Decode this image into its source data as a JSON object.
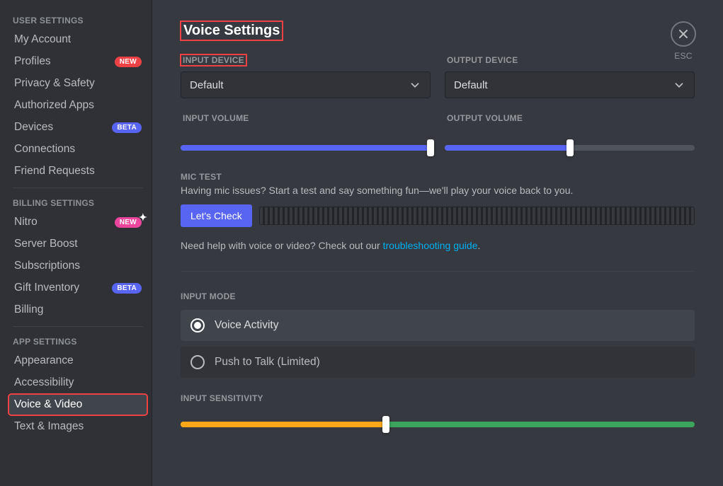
{
  "sidebar": {
    "sections": {
      "user": {
        "header": "USER SETTINGS",
        "items": [
          {
            "label": "My Account"
          },
          {
            "label": "Profiles",
            "badge": "NEW",
            "badgeStyle": "new-red"
          },
          {
            "label": "Privacy & Safety"
          },
          {
            "label": "Authorized Apps"
          },
          {
            "label": "Devices",
            "badge": "BETA",
            "badgeStyle": "beta"
          },
          {
            "label": "Connections"
          },
          {
            "label": "Friend Requests"
          }
        ]
      },
      "billing": {
        "header": "BILLING SETTINGS",
        "items": [
          {
            "label": "Nitro",
            "badge": "NEW",
            "badgeStyle": "new-fuchsia",
            "sparkle": true
          },
          {
            "label": "Server Boost"
          },
          {
            "label": "Subscriptions"
          },
          {
            "label": "Gift Inventory",
            "badge": "BETA",
            "badgeStyle": "beta"
          },
          {
            "label": "Billing"
          }
        ]
      },
      "app": {
        "header": "APP SETTINGS",
        "items": [
          {
            "label": "Appearance"
          },
          {
            "label": "Accessibility"
          },
          {
            "label": "Voice & Video",
            "selected": true
          },
          {
            "label": "Text & Images"
          }
        ]
      }
    }
  },
  "close": {
    "esc": "ESC"
  },
  "page": {
    "title": "Voice Settings",
    "inputDeviceLabel": "INPUT DEVICE",
    "outputDeviceLabel": "OUTPUT DEVICE",
    "inputDeviceValue": "Default",
    "outputDeviceValue": "Default",
    "inputVolumeLabel": "INPUT VOLUME",
    "outputVolumeLabel": "OUTPUT VOLUME",
    "inputVolumePercent": 100,
    "outputVolumePercent": 50,
    "micTest": {
      "header": "MIC TEST",
      "helper": "Having mic issues? Start a test and say something fun—we'll play your voice back to you.",
      "button": "Let's Check"
    },
    "help": {
      "prefix": "Need help with voice or video? Check out our ",
      "linkText": "troubleshooting guide",
      "suffix": "."
    },
    "inputMode": {
      "header": "INPUT MODE",
      "options": [
        {
          "label": "Voice Activity",
          "selected": true
        },
        {
          "label": "Push to Talk (Limited)",
          "selected": false
        }
      ]
    },
    "inputSensitivity": {
      "header": "INPUT SENSITIVITY",
      "percent": 40
    }
  }
}
